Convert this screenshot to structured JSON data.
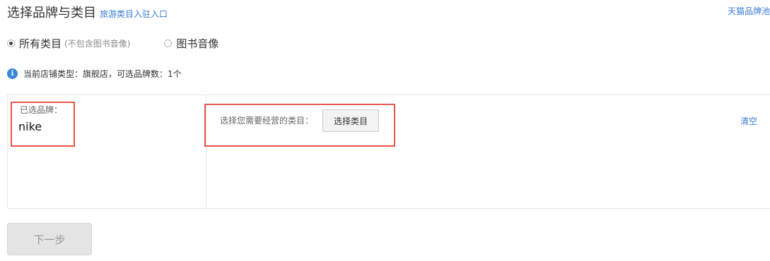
{
  "header": {
    "title": "选择品牌与类目",
    "link": "旅游类目入驻入口",
    "right_link": "天猫品牌池"
  },
  "category_scope": {
    "options": [
      {
        "label": "所有类目",
        "note": "(不包含图书音像)",
        "selected": true
      },
      {
        "label": "图书音像",
        "note": "",
        "selected": false
      }
    ]
  },
  "info": {
    "icon": "info-icon",
    "text": "当前店铺类型：旗舰店，可选品牌数：1个"
  },
  "panel": {
    "selected_brand_label": "已选品牌：",
    "selected_brand": "nike",
    "category_prompt": "选择您需要经营的类目：",
    "select_category_button": "选择类目",
    "clear_link": "清空"
  },
  "footer": {
    "next_button": "下一步"
  },
  "colors": {
    "link": "#3a7bd5",
    "highlight_border": "#e4574c",
    "info_icon": "#3a86d6",
    "disabled_button_bg": "#e4e4e4"
  }
}
